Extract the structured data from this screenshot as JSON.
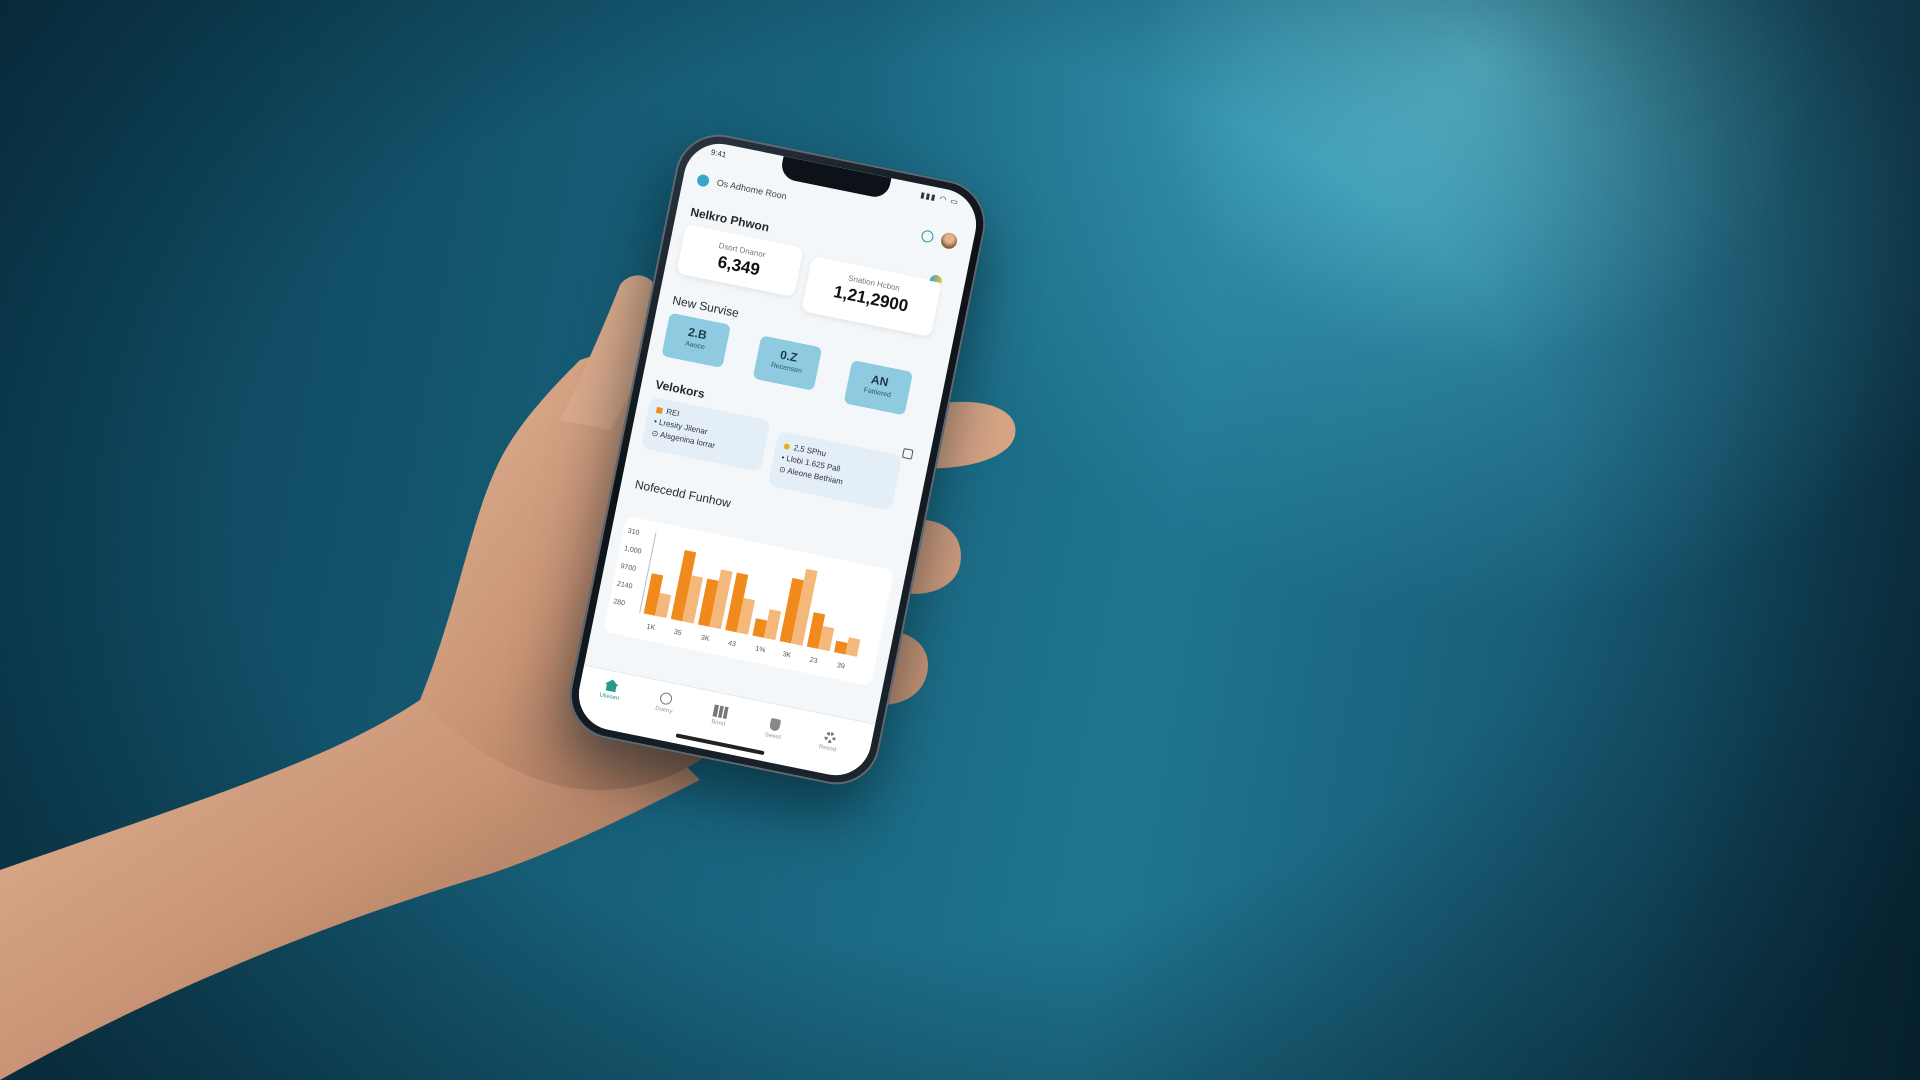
{
  "status": {
    "time": "9:41"
  },
  "app": {
    "title": "Os Adhome Roon"
  },
  "header": {
    "section_title": "Nelkro Phwon"
  },
  "stats": [
    {
      "label": "Dsort Dnanor",
      "value": "6,349"
    },
    {
      "label": "Snation Hcbon",
      "value": "1,21,2900"
    }
  ],
  "new_service": {
    "title": "New Survise",
    "chips": [
      {
        "value": "2.B",
        "label": "Aaoce"
      },
      {
        "value": "0.Z",
        "label": "Recensen"
      },
      {
        "value": "AN",
        "label": "Fattiered"
      }
    ]
  },
  "vehicles": {
    "title": "Velokors",
    "cards": [
      {
        "rows": [
          "REI",
          "Lresity Jilenar",
          "Alsgenina lorrar"
        ],
        "dot_color": "#f0901c"
      },
      {
        "rows": [
          "2,5 SPhu",
          "Llobi 1.625 Pall",
          "Aleone Bethiam"
        ],
        "dot_color": "#e8b21a"
      }
    ]
  },
  "chart": {
    "title": "Nofecedd Funhow",
    "chart_data": {
      "type": "bar",
      "title": "Nofecedd Funhow",
      "categories": [
        "1K",
        "35",
        "3K",
        "43",
        "1%",
        "3K",
        "23",
        "39"
      ],
      "y_tick_labels": [
        "310",
        "1,000",
        "9700",
        "2140",
        "280"
      ],
      "series": [
        {
          "values": [
            7,
            12,
            8,
            10,
            3,
            11,
            6,
            2
          ],
          "color": "#f08a1c"
        },
        {
          "values": [
            4,
            8,
            10,
            6,
            5,
            13,
            4,
            3
          ],
          "color": "#f4b97a"
        }
      ]
    }
  },
  "nav": [
    {
      "label": "Uliesen",
      "icon": "home-icon"
    },
    {
      "label": "Dueny",
      "icon": "search-icon"
    },
    {
      "label": "Bnnd",
      "icon": "chart-icon"
    },
    {
      "label": "Sewel",
      "icon": "shield-icon"
    },
    {
      "label": "Resnd",
      "icon": "gear-icon"
    }
  ],
  "colors": {
    "background": "#1a6680",
    "chip": "#8fcbe0",
    "bar_primary": "#f08a1c",
    "bar_secondary": "#f4b97a"
  }
}
